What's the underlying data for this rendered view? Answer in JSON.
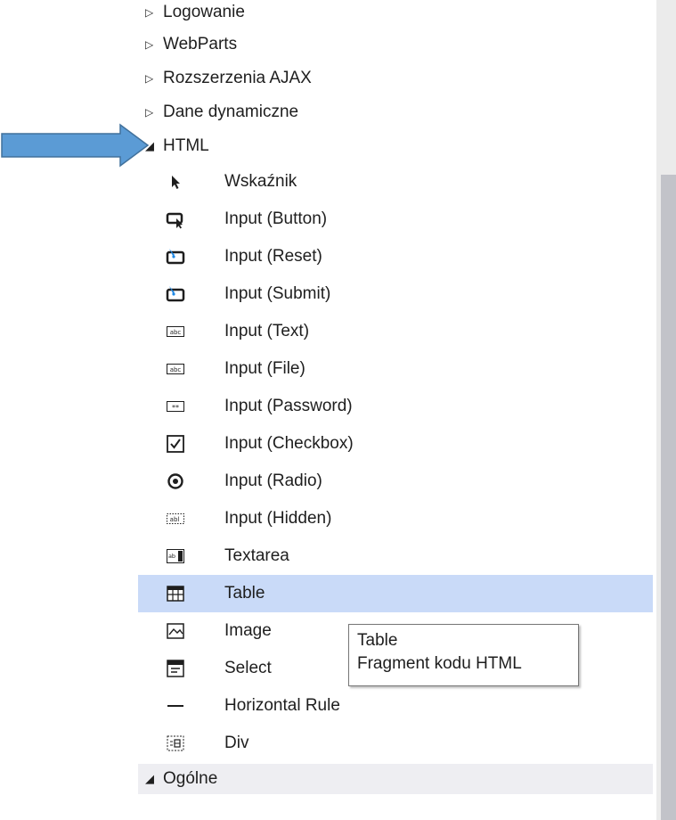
{
  "categories_collapsed": [
    {
      "label": "Logowanie"
    },
    {
      "label": "WebParts"
    },
    {
      "label": "Rozszerzenia AJAX"
    },
    {
      "label": "Dane dynamiczne"
    }
  ],
  "html_category": {
    "label": "HTML",
    "expanded": true
  },
  "html_items": [
    {
      "label": "Wskaźnik",
      "icon": "pointer-icon"
    },
    {
      "label": "Input (Button)",
      "icon": "button-icon"
    },
    {
      "label": "Input (Reset)",
      "icon": "reset-icon"
    },
    {
      "label": "Input (Submit)",
      "icon": "submit-icon"
    },
    {
      "label": "Input (Text)",
      "icon": "textbox-icon"
    },
    {
      "label": "Input (File)",
      "icon": "file-input-icon"
    },
    {
      "label": "Input (Password)",
      "icon": "password-icon"
    },
    {
      "label": "Input (Checkbox)",
      "icon": "checkbox-icon"
    },
    {
      "label": "Input (Radio)",
      "icon": "radio-icon"
    },
    {
      "label": "Input (Hidden)",
      "icon": "hidden-field-icon"
    },
    {
      "label": "Textarea",
      "icon": "textarea-icon"
    },
    {
      "label": "Table",
      "icon": "table-icon",
      "selected": true
    },
    {
      "label": "Image",
      "icon": "image-icon"
    },
    {
      "label": "Select",
      "icon": "select-icon"
    },
    {
      "label": "Horizontal Rule",
      "icon": "horizontal-rule-icon"
    },
    {
      "label": "Div",
      "icon": "div-icon"
    }
  ],
  "general_category": {
    "label": "Ogólne",
    "expanded": true
  },
  "tooltip": {
    "title": "Table",
    "description": "Fragment kodu HTML"
  },
  "colors": {
    "selection": "#c9daf8",
    "arrow_fill": "#5b9bd5",
    "arrow_stroke": "#41719c"
  }
}
